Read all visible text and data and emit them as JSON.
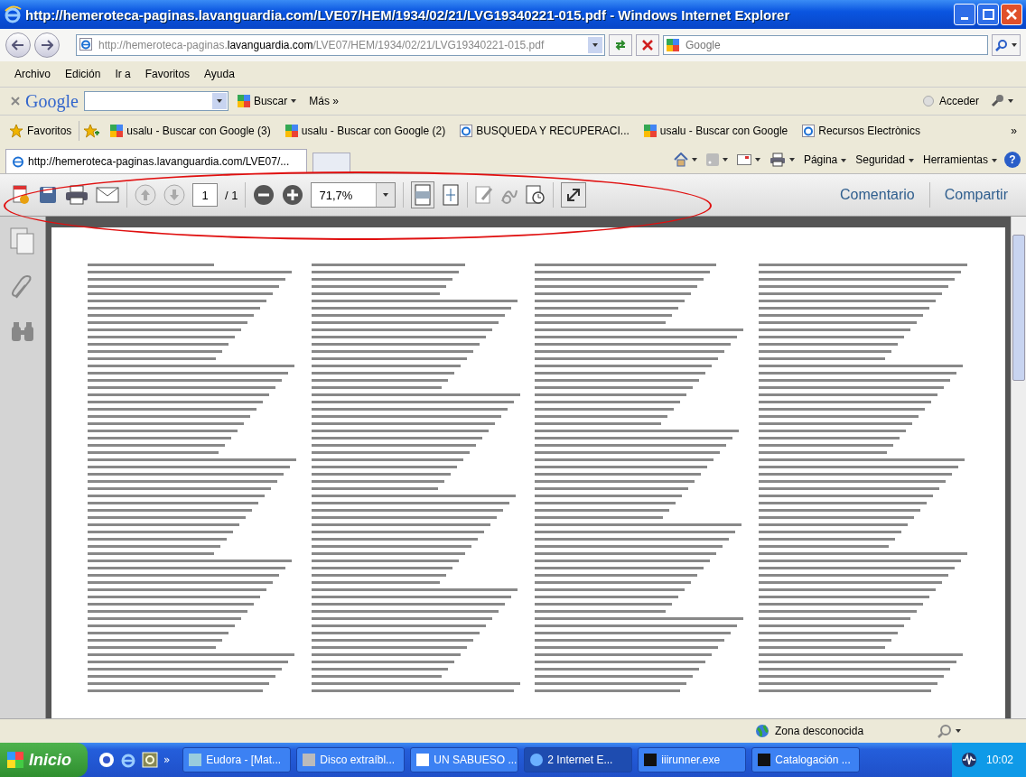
{
  "window": {
    "title": "http://hemeroteca-paginas.lavanguardia.com/LVE07/HEM/1934/02/21/LVG19340221-015.pdf - Windows Internet Explorer"
  },
  "address_bar": {
    "url_prefix": "http://hemeroteca-paginas.",
    "url_domain": "lavanguardia.com",
    "url_path": "/LVE07/HEM/1934/02/21/LVG19340221-015.pdf",
    "search_placeholder": "Google"
  },
  "menu": [
    "Archivo",
    "Edición",
    "Ir a",
    "Favoritos",
    "Ayuda"
  ],
  "google_toolbar": {
    "logo": "Google",
    "buscar": "Buscar",
    "mas": "Más »",
    "acceder": "Acceder"
  },
  "favorites_bar": {
    "label": "Favoritos",
    "items": [
      {
        "kind": "google",
        "label": "usalu - Buscar con Google (3)"
      },
      {
        "kind": "google",
        "label": "usalu - Buscar con Google (2)"
      },
      {
        "kind": "ie",
        "label": "BUSQUEDA Y RECUPERACI..."
      },
      {
        "kind": "google",
        "label": "usalu - Buscar con Google"
      },
      {
        "kind": "ie",
        "label": "Recursos Electrònics"
      }
    ],
    "more": "»"
  },
  "tab": {
    "label": "http://hemeroteca-paginas.lavanguardia.com/LVE07/...",
    "selected": true
  },
  "command_bar": [
    "Página",
    "Seguridad",
    "Herramientas"
  ],
  "help": "?",
  "pdf_toolbar": {
    "page": "1",
    "page_total": "/ 1",
    "zoom": "71,7%",
    "comentario": "Comentario",
    "compartir": "Compartir"
  },
  "status_bar": {
    "zone": "Zona desconocida"
  },
  "taskbar": {
    "start": "Inicio",
    "more": "»",
    "tasks": [
      {
        "kind": "mail",
        "label": "Eudora - [Mat...",
        "selected": false
      },
      {
        "kind": "disk",
        "label": "Disco extraíbl...",
        "selected": false
      },
      {
        "kind": "word",
        "label": "UN SABUESO ...",
        "selected": false
      },
      {
        "kind": "ie",
        "label": "2 Internet E...",
        "selected": true
      },
      {
        "kind": "app",
        "label": "iiirunner.exe",
        "selected": false
      },
      {
        "kind": "app",
        "label": "Catalogación ...",
        "selected": false
      }
    ],
    "clock": "10:02"
  }
}
